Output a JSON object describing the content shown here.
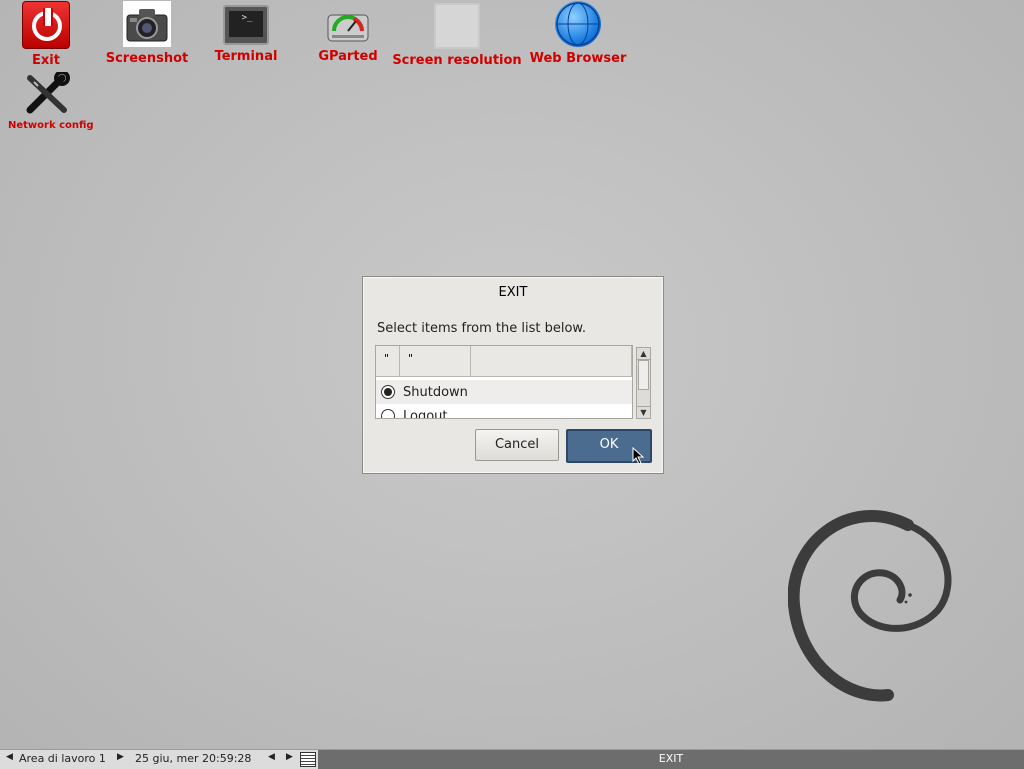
{
  "desktop": {
    "icons": [
      {
        "label": "Exit",
        "icon": "power-icon"
      },
      {
        "label": "Screenshot",
        "icon": "camera-icon"
      },
      {
        "label": "Terminal",
        "icon": "terminal-icon"
      },
      {
        "label": "GParted",
        "icon": "disk-gauge-icon"
      },
      {
        "label": "Screen resolution",
        "icon": "monitor-icon"
      },
      {
        "label": "Web Browser",
        "icon": "globe-icon"
      },
      {
        "label": "Network config",
        "icon": "tools-icon"
      }
    ],
    "label_color": "#d00000"
  },
  "dialog": {
    "title": "EXIT",
    "prompt": "Select items from the list below.",
    "columns": [
      "\"",
      "\"",
      ""
    ],
    "options": [
      {
        "label": "Shutdown",
        "selected": true
      },
      {
        "label": "Logout",
        "selected": false
      }
    ],
    "cancel_label": "Cancel",
    "ok_label": "OK",
    "ok_color": "#4b6c8f"
  },
  "taskbar": {
    "workspace": "Area di lavoro 1",
    "clock": "25 giu, mer 20:59:28",
    "active_task": "EXIT"
  }
}
